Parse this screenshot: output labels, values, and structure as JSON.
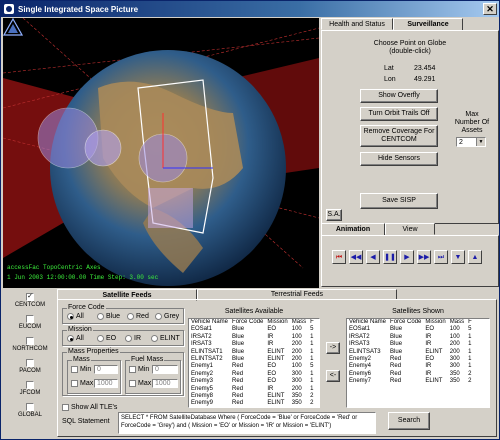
{
  "window": {
    "title": "Single Integrated Space Picture",
    "close_glyph": "✕"
  },
  "viewport": {
    "overlay_line1": "accessFac TopoCentric Axes",
    "overlay_line2": "1 Jun 2003 12:00:00.00     Time Step: 3.00 sec"
  },
  "right_tabs": [
    "Health and Status",
    "Surveillance"
  ],
  "surveillance": {
    "choose_point": "Choose Point on Globe",
    "double_click": "(double-click)",
    "lat_label": "Lat",
    "lat_value": "23.454",
    "lon_label": "Lon",
    "lon_value": "49.291",
    "show_overfly": "Show Overfly",
    "turn_orbit": "Turn Orbit Trails Off",
    "remove_coverage_1": "Remove Coverage For",
    "remove_coverage_2": "CENTCOM",
    "hide_sensors": "Hide Sensors",
    "max_assets_1": "Max",
    "max_assets_2": "Number Of",
    "max_assets_3": "Assets",
    "max_assets_value": "2",
    "save_sisp": "Save SISP",
    "sa_button": "S.A."
  },
  "anim_tabs": [
    "Animation",
    "View"
  ],
  "sidebar": {
    "items": [
      {
        "label": "CENTCOM",
        "checked": true
      },
      {
        "label": "EUCOM",
        "checked": false
      },
      {
        "label": "NORTHCOM",
        "checked": false
      },
      {
        "label": "PACOM",
        "checked": false
      },
      {
        "label": "JFCOM",
        "checked": false
      },
      {
        "label": "GLOBAL",
        "checked": false
      }
    ]
  },
  "feeds_tabs": [
    "Satellite Feeds",
    "Terrestrial Feeds"
  ],
  "filters": {
    "force_code_title": "Force Code",
    "force_code_options": [
      "All",
      "Blue",
      "Red",
      "Grey"
    ],
    "force_code_selected": "All",
    "mission_title": "Mission",
    "mission_options": [
      "All",
      "EO",
      "IR",
      "ELINT"
    ],
    "mission_selected": "All",
    "mass_properties_title": "Mass Properties",
    "mass_title": "Mass",
    "fuel_mass_title": "Fuel Mass",
    "min_label": "Min",
    "max_label": "Max",
    "mass_min_value": "0",
    "mass_max_value": "1000",
    "fuel_min_value": "0",
    "fuel_max_value": "1000",
    "show_all_tle": "Show All TLE's"
  },
  "satellites_available": {
    "title": "Satellites Available",
    "columns": [
      "Vehicle Name",
      "Force Code",
      "Mission",
      "Mass",
      "F"
    ],
    "rows": [
      [
        "EOSat1",
        "Blue",
        "EO",
        "100",
        "5"
      ],
      [
        "IRSAT2",
        "Blue",
        "IR",
        "100",
        "1"
      ],
      [
        "IRSAT3",
        "Blue",
        "IR",
        "200",
        "1"
      ],
      [
        "ELINTSAT1",
        "Blue",
        "ELINT",
        "200",
        "1"
      ],
      [
        "ELINTSAT2",
        "Blue",
        "ELINT",
        "200",
        "1"
      ],
      [
        "Enemy1",
        "Red",
        "EO",
        "100",
        "5"
      ],
      [
        "Enemy2",
        "Red",
        "EO",
        "300",
        "1"
      ],
      [
        "Enemy3",
        "Red",
        "EO",
        "300",
        "1"
      ],
      [
        "Enemy5",
        "Red",
        "IR",
        "200",
        "1"
      ],
      [
        "Enemy8",
        "Red",
        "ELINT",
        "350",
        "2"
      ],
      [
        "Enemy9",
        "Red",
        "ELINT",
        "350",
        "2"
      ]
    ]
  },
  "move_right": "->",
  "move_left": "<-",
  "satellites_shown": {
    "title": "Satellites Shown",
    "columns": [
      "Vehicle Name",
      "Force Code",
      "Mission",
      "Mass",
      "F"
    ],
    "rows": [
      [
        "EOSat1",
        "Blue",
        "EO",
        "100",
        "5"
      ],
      [
        "IRSAT2",
        "Blue",
        "IR",
        "100",
        "1"
      ],
      [
        "IRSAT3",
        "Blue",
        "IR",
        "200",
        "1"
      ],
      [
        "ELINTSAT3",
        "Blue",
        "ELINT",
        "200",
        "1"
      ],
      [
        "Enemy2",
        "Red",
        "EO",
        "300",
        "1"
      ],
      [
        "Enemy4",
        "Red",
        "IR",
        "300",
        "1"
      ],
      [
        "Enemy6",
        "Red",
        "IR",
        "350",
        "2"
      ],
      [
        "Enemy7",
        "Red",
        "ELINT",
        "350",
        "2"
      ]
    ]
  },
  "sql": {
    "label": "SQL Statement",
    "text": "SELECT * FROM SatelliteDatabase Where  ( ForceCode = 'Blue' or ForceCode = 'Red' or ForceCode = 'Grey') and  ( Mission = 'EO' or Mission = 'IR' or Mission = 'ELINT')",
    "search": "Search"
  },
  "colors": {
    "titlebar": "#0a246a",
    "overlay_text": "#3cf03c",
    "coverage_red": "#c01818"
  }
}
